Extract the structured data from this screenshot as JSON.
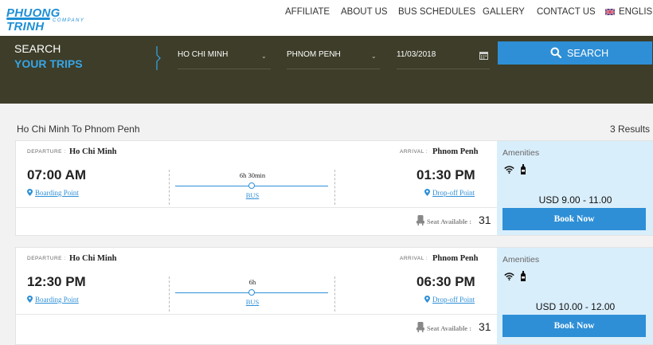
{
  "brand": {
    "name": "PHUONG TRINH",
    "sub": "COMPANY"
  },
  "nav": {
    "items": [
      "AFFILIATE",
      "ABOUT US",
      "BUS SCHEDULES",
      "GALLERY",
      "CONTACT US"
    ],
    "language": "ENGLISH"
  },
  "search": {
    "title_line1": "SEARCH",
    "title_line2": "YOUR TRIPS",
    "from": "HO CHI MINH",
    "to": "PHNOM PENH",
    "date": "11/03/2018",
    "button_label": "SEARCH"
  },
  "summary": {
    "route": "Ho Chi Minh To Phnom Penh",
    "count": "3 Results"
  },
  "labels": {
    "departure": "DEPARTURE :",
    "arrival": "ARRIVAL :",
    "boarding": "Boarding Point",
    "dropoff": "Drop-off Point",
    "seat": "Seat Available :",
    "amenities": "Amenities",
    "book": "Book Now"
  },
  "trips": [
    {
      "from_city": "Ho Chi Minh",
      "to_city": "Phnom Penh",
      "depart_time": "07:00 AM",
      "arrive_time": "01:30 PM",
      "duration": "6h 30min",
      "vehicle": "BUS",
      "seats": "31",
      "price": "USD 9.00 - 11.00"
    },
    {
      "from_city": "Ho Chi Minh",
      "to_city": "Phnom Penh",
      "depart_time": "12:30 PM",
      "arrive_time": "06:30 PM",
      "duration": "6h",
      "vehicle": "BUS",
      "seats": "31",
      "price": "USD 10.00 - 12.00"
    }
  ],
  "colors": {
    "accent": "#2e8fd6",
    "search_bg": "#3d3d29",
    "amenities_bg": "#d9eefb"
  }
}
